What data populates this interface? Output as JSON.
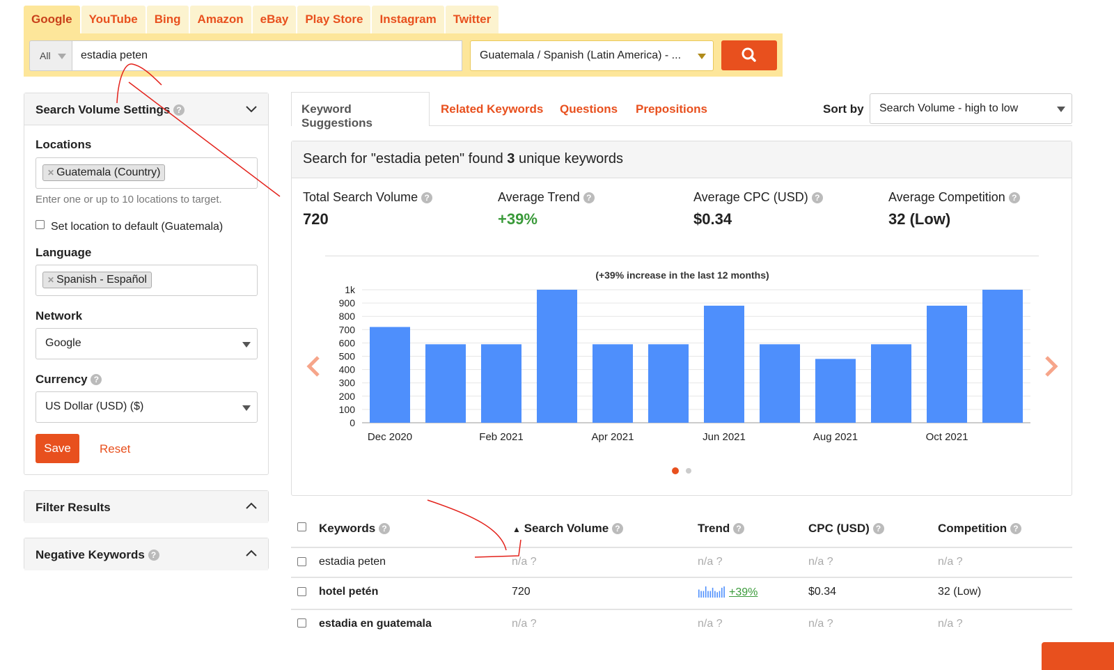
{
  "engine_tabs": [
    "Google",
    "YouTube",
    "Bing",
    "Amazon",
    "eBay",
    "Play Store",
    "Instagram",
    "Twitter"
  ],
  "search": {
    "type": "All",
    "query": "estadia peten",
    "location_language": "Guatemala / Spanish (Latin America) - ...",
    "search_icon": "search-icon"
  },
  "settings": {
    "title": "Search Volume Settings",
    "locations_label": "Locations",
    "location_chip": "Guatemala (Country)",
    "locations_hint": "Enter one or up to 10 locations to target.",
    "default_checkbox": "Set location to default (Guatemala)",
    "language_label": "Language",
    "language_chip": "Spanish - Español",
    "network_label": "Network",
    "network_value": "Google",
    "currency_label": "Currency",
    "currency_value": "US Dollar (USD) ($)",
    "save": "Save",
    "reset": "Reset"
  },
  "filter_title": "Filter Results",
  "negative_title": "Negative Keywords",
  "main_tabs": [
    "Keyword Suggestions",
    "Related Keywords",
    "Questions",
    "Prepositions"
  ],
  "sort": {
    "label": "Sort by",
    "value": "Search Volume - high to low"
  },
  "summary": {
    "prefix": "Search for \"estadia peten\" found ",
    "count": "3",
    "suffix": " unique keywords"
  },
  "stats": [
    {
      "label": "Total Search Volume",
      "value": "720"
    },
    {
      "label": "Average Trend",
      "value": "+39%"
    },
    {
      "label": "Average CPC (USD)",
      "value": "$0.34"
    },
    {
      "label": "Average Competition",
      "value": "32 (Low)"
    }
  ],
  "chart_data": {
    "type": "bar",
    "title": "(+39% increase in the last 12 months)",
    "categories": [
      "Dec 2020",
      "Jan 2021",
      "Feb 2021",
      "Mar 2021",
      "Apr 2021",
      "May 2021",
      "Jun 2021",
      "Jul 2021",
      "Aug 2021",
      "Sep 2021",
      "Oct 2021",
      "Nov 2021"
    ],
    "values": [
      720,
      590,
      590,
      1000,
      590,
      590,
      880,
      590,
      480,
      590,
      880,
      1000
    ],
    "xtick_labels": [
      "Dec 2020",
      "Feb 2021",
      "Apr 2021",
      "Jun 2021",
      "Aug 2021",
      "Oct 2021"
    ],
    "yticks": [
      "0",
      "100",
      "200",
      "300",
      "400",
      "500",
      "600",
      "700",
      "800",
      "900",
      "1k"
    ],
    "ylim": [
      0,
      1000
    ],
    "grid": true,
    "color": "#4e8ffc"
  },
  "table": {
    "headers": [
      "Keywords",
      "Search Volume",
      "Trend",
      "CPC (USD)",
      "Competition"
    ],
    "rows": [
      {
        "keyword": "estadia peten",
        "volume": "n/a ?",
        "trend": "n/a ?",
        "cpc": "n/a ?",
        "competition": "n/a ?",
        "bold": false
      },
      {
        "keyword": "hotel petén",
        "volume": "720",
        "trend": "+39%",
        "cpc": "$0.34",
        "competition": "32 (Low)",
        "bold": true
      },
      {
        "keyword": "estadia en guatemala",
        "volume": "n/a ?",
        "trend": "n/a ?",
        "cpc": "n/a ?",
        "competition": "n/a ?",
        "bold": true
      }
    ]
  },
  "colors": {
    "accent": "#e8501e",
    "tabbar": "#fde69a",
    "bar": "#4e8ffc",
    "positive": "#3a9a3a"
  }
}
